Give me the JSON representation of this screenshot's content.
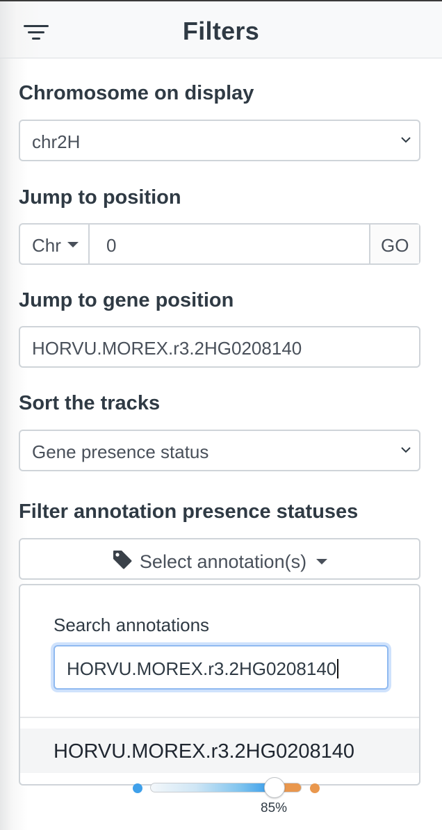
{
  "header": {
    "title": "Filters",
    "menu_icon": "filter-menu-icon"
  },
  "chromosome": {
    "label": "Chromosome on display",
    "selected": "chr2H"
  },
  "jump_position": {
    "label": "Jump to position",
    "chr_button": "Chr",
    "value": "0",
    "go_button": "GO"
  },
  "jump_gene": {
    "label": "Jump to gene position",
    "value": "HORVU.MOREX.r3.2HG0208140"
  },
  "sort": {
    "label": "Sort the tracks",
    "selected": "Gene presence status"
  },
  "annotation_filter": {
    "label": "Filter annotation presence statuses",
    "select_button": "Select annotation(s)",
    "search_label": "Search annotations",
    "search_value": "HORVU.MOREX.r3.2HG0208140",
    "results": [
      "HORVU.MOREX.r3.2HG0208140"
    ]
  },
  "slider": {
    "value_label": "85%",
    "value": 0.85
  },
  "colors": {
    "text": "#2f3a44",
    "border": "#cfd4d9",
    "focus": "#8fb9f0",
    "slider_blue": "#3fa0ea",
    "slider_orange": "#e9974d"
  }
}
